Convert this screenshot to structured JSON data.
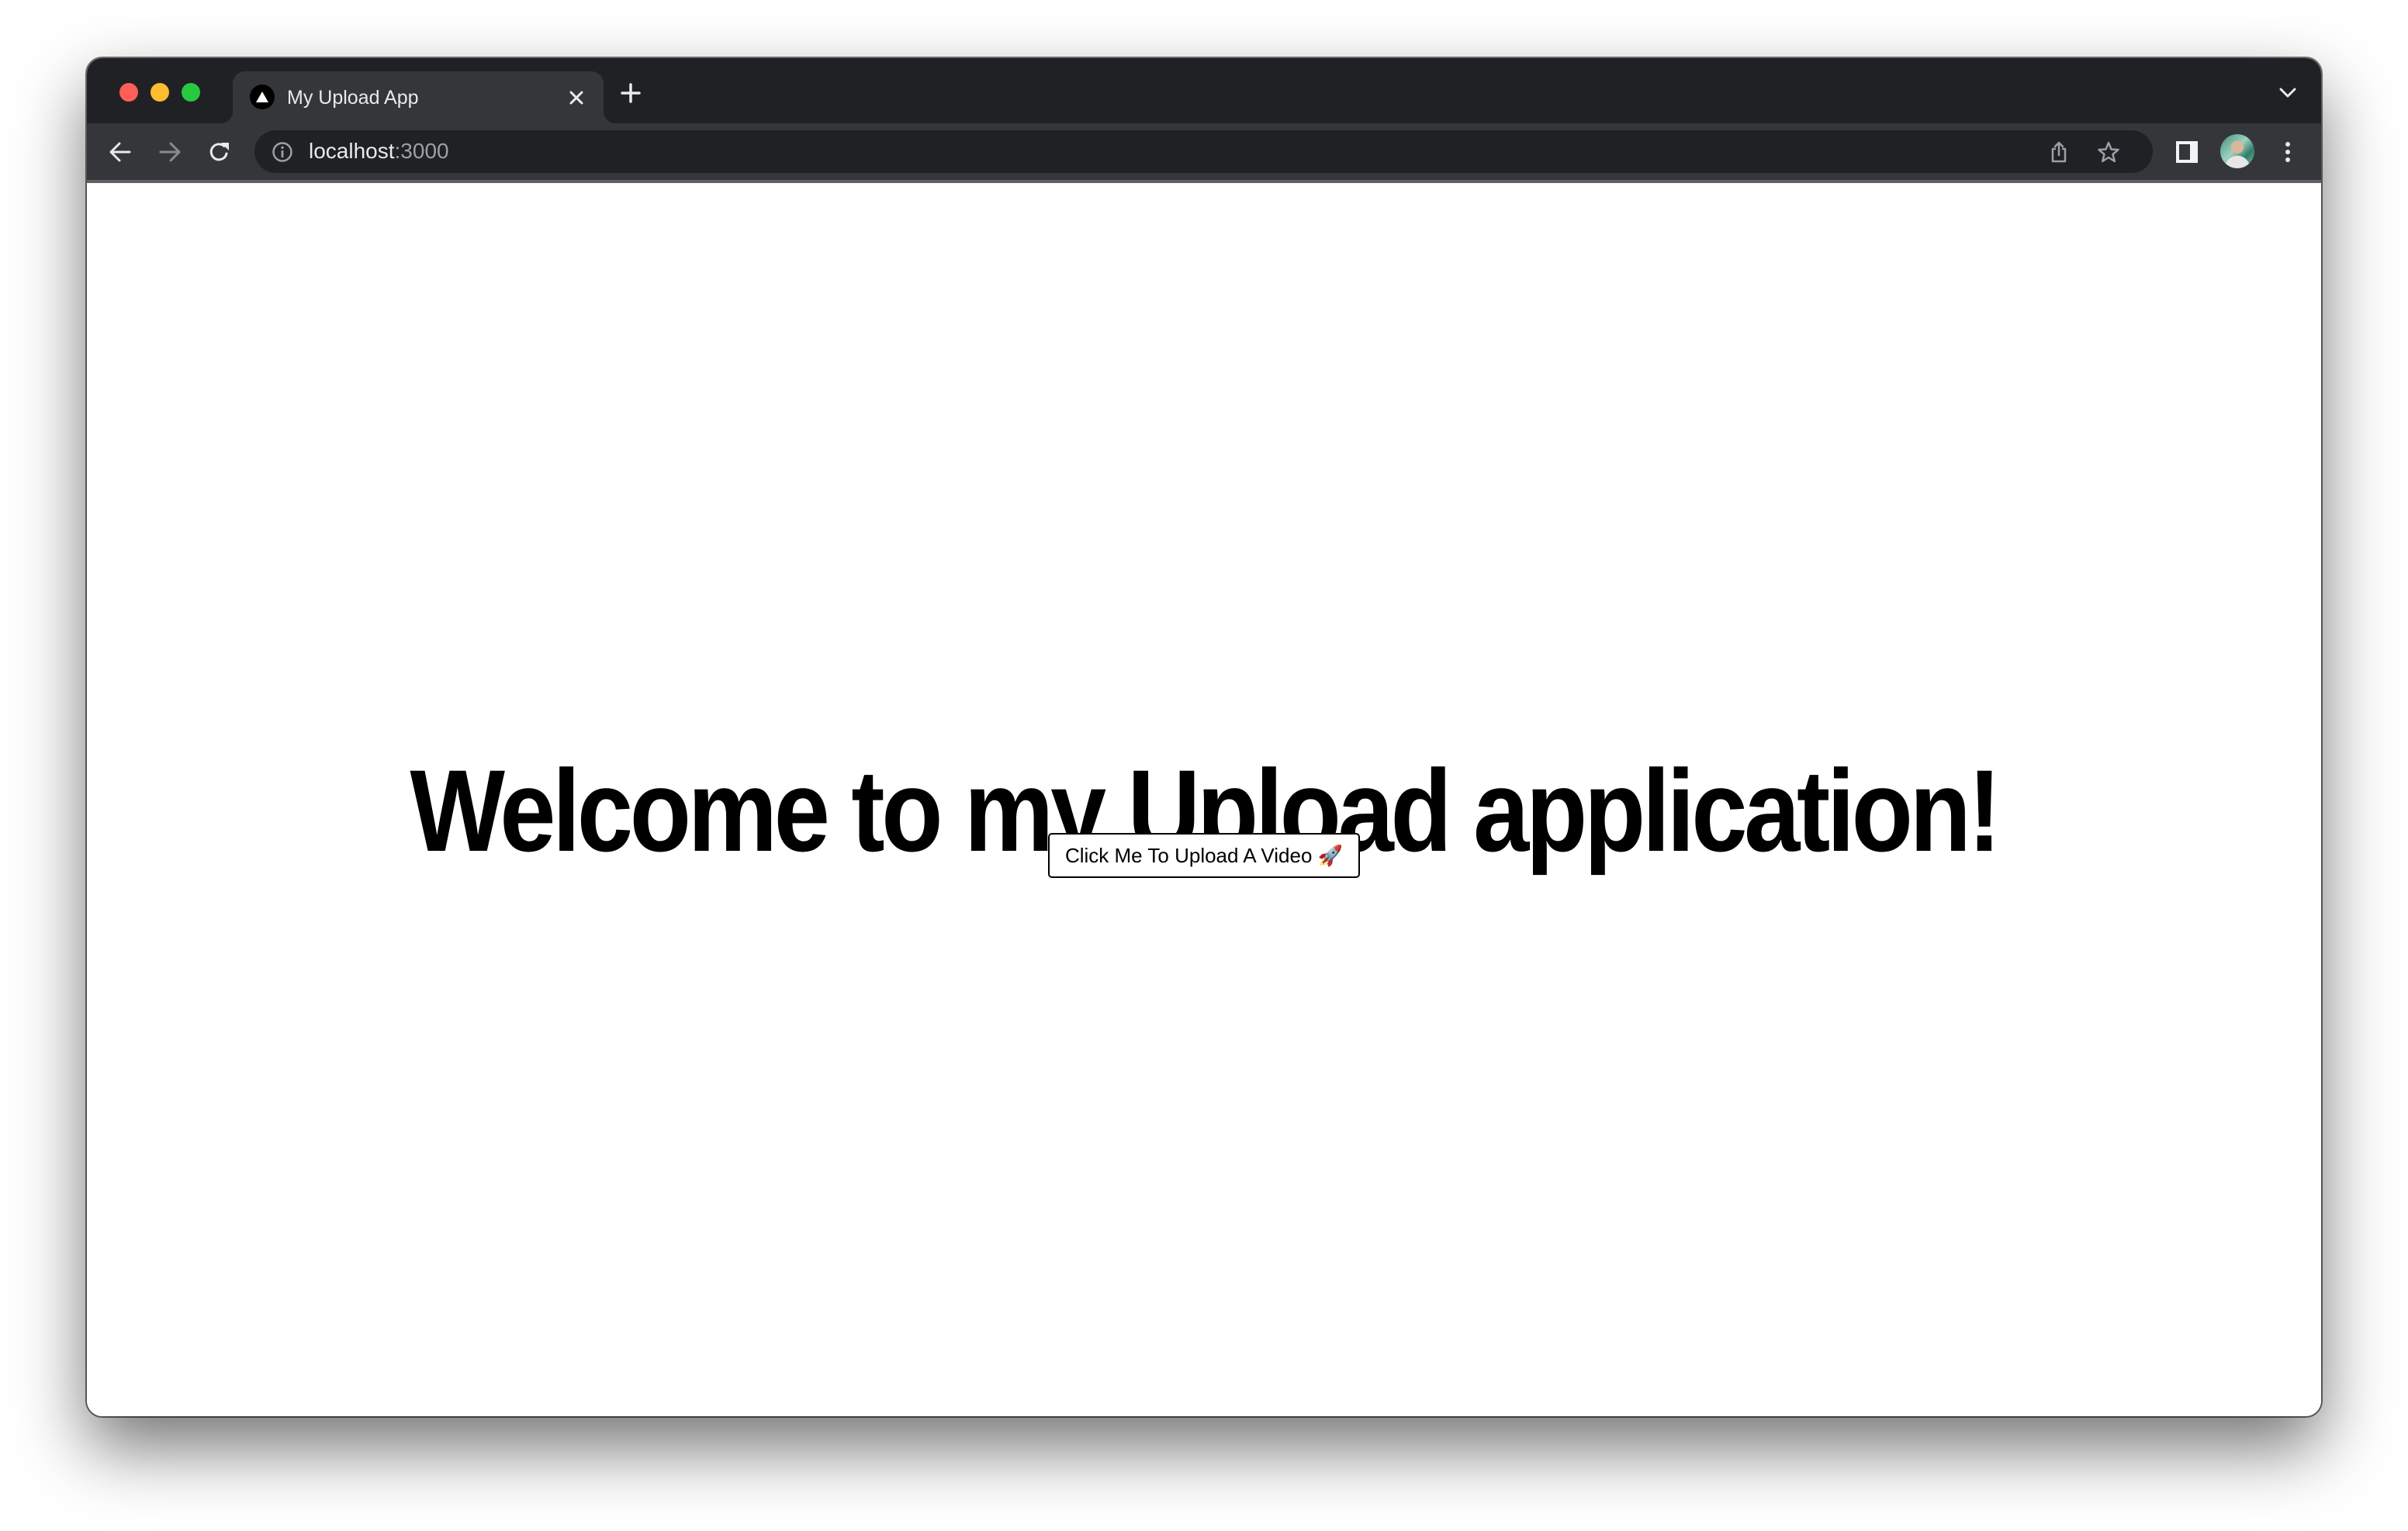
{
  "browser": {
    "tab": {
      "title": "My Upload App",
      "favicon": "triangle-logo-icon"
    },
    "address_bar": {
      "host": "localhost",
      "port": ":3000"
    },
    "icons": {
      "back": "arrow-left-icon",
      "forward": "arrow-right-icon",
      "reload": "reload-icon",
      "site_info": "info-icon",
      "share": "share-icon",
      "bookmark": "star-icon",
      "side_panel": "side-panel-icon",
      "profile": "avatar",
      "menu": "kebab-menu-icon",
      "new_tab": "plus-icon",
      "close_tab": "close-icon",
      "tab_search": "chevron-down-icon"
    },
    "colors": {
      "traffic_red": "#ff5f57",
      "traffic_yellow": "#febc2e",
      "traffic_green": "#28c840",
      "frame": "#202124",
      "toolbar": "#35363a"
    }
  },
  "page": {
    "heading": "Welcome to my Upload application!",
    "upload_button_label": "Click Me To Upload A Video 🚀"
  }
}
